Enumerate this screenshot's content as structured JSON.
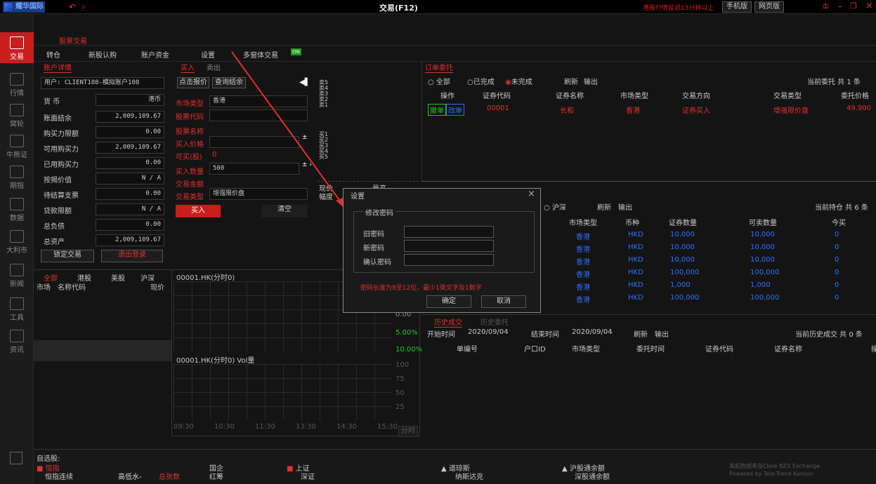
{
  "titlebar": {
    "logo": "耀华国际",
    "title": "交易(F12)",
    "delay_notice": "港股行情延迟15分钟以上",
    "mobile": "手机版",
    "web": "网页版"
  },
  "sidebar": {
    "items": [
      {
        "label": "交易"
      },
      {
        "label": "行情"
      },
      {
        "label": "窝轮"
      },
      {
        "label": "牛熊证"
      },
      {
        "label": "期指"
      },
      {
        "label": "数据"
      },
      {
        "label": "大利市"
      },
      {
        "label": "新闻"
      },
      {
        "label": "工具"
      },
      {
        "label": "资讯"
      }
    ]
  },
  "toolbar": {
    "section": "股票交易",
    "transfer": "转仓",
    "ipo": "新股认购",
    "funds": "账户资金",
    "settings": "设置",
    "multi": "多窗体交易",
    "toggle": "ON"
  },
  "account": {
    "tab": "账户详情",
    "user": "用户: CLIENT108-模拟账户108",
    "currency_label": "货 币",
    "currency": "港币",
    "rows": [
      {
        "label": "账面结余",
        "value": "2,009,109.67"
      },
      {
        "label": "购买力限额",
        "value": "0.00"
      },
      {
        "label": "可用购买力",
        "value": "2,009,109.67"
      },
      {
        "label": "已用购买力",
        "value": "0.00"
      },
      {
        "label": "按揭价值",
        "value": "N / A"
      },
      {
        "label": "待结算支票",
        "value": "0.00"
      },
      {
        "label": "贷款限额",
        "value": "N / A"
      },
      {
        "label": "总负债",
        "value": "0.00"
      },
      {
        "label": "总资产",
        "value": "2,009,109.67"
      }
    ],
    "lock": "锁定交易",
    "logout": "退出登录"
  },
  "order_form": {
    "buy_tab": "买入",
    "sell_tab": "卖出",
    "quote": "点击报价",
    "query": "查询结余",
    "market_label": "市场类型",
    "market": "香港",
    "code_label": "股票代码",
    "name_label": "股票名称",
    "price_label": "买入价格",
    "canbuy_label": "可买(股)",
    "canbuy": "0",
    "qty_label": "买入数量",
    "qty": "500",
    "amount_label": "交易金额",
    "type_label": "交易类型",
    "type": "增强限价盘",
    "buy_btn": "买入",
    "clear_btn": "清空",
    "sell_levels": [
      "卖5",
      "卖4",
      "卖3",
      "卖2",
      "卖1"
    ],
    "buy_levels": [
      "买1",
      "买2",
      "买3",
      "买4",
      "买5"
    ],
    "last_label": "现价",
    "change_label": "幅度",
    "high_label": "最高"
  },
  "watch": {
    "tabs": [
      "全部",
      "港股",
      "美股",
      "沪深"
    ],
    "col_market": "市场",
    "col_name": "名称代码",
    "col_price": "现价",
    "dash": "-"
  },
  "chart": {
    "title": "00001.HK(分时0)",
    "vol_title": "00001.HK(分时0) Vol量",
    "pct_labels": [
      "0.00",
      "5.00%",
      "10.00%"
    ],
    "vol_labels": [
      "100",
      "75",
      "50",
      "25"
    ],
    "times": [
      "09:30",
      "10:30",
      "11:30",
      "13:30",
      "14:30",
      "15:30"
    ],
    "mode": "分时"
  },
  "orders": {
    "tab": "订单委托",
    "filters": [
      "全部",
      "已完成",
      "未完成"
    ],
    "refresh": "刷新",
    "export": "输出",
    "summary": "当前委托  共 1 条",
    "headers": [
      "操作",
      "证券代码",
      "证券名称",
      "市场类型",
      "交易方向",
      "交易类型",
      "委托价格"
    ],
    "row": {
      "cancel": "撤单",
      "modify": "改单",
      "code": "00001",
      "name": "长和",
      "market": "香港",
      "direction": "证券买入",
      "type": "增强限价盘",
      "price": "49.900"
    }
  },
  "positions": {
    "filter": "沪深",
    "refresh": "刷新",
    "export": "输出",
    "summary": "当前持仓  共 6 条",
    "headers": [
      "市场类型",
      "币种",
      "证券数量",
      "可卖数量",
      "今买"
    ],
    "rows": [
      {
        "market": "香港",
        "cur": "HKD",
        "qty": "10,000",
        "sell": "10,000",
        "today": "0"
      },
      {
        "market": "香港",
        "cur": "HKD",
        "qty": "10,000",
        "sell": "10,000",
        "today": "0"
      },
      {
        "market": "香港",
        "cur": "HKD",
        "qty": "10,000",
        "sell": "10,000",
        "today": "0"
      },
      {
        "market": "香港",
        "cur": "HKD",
        "qty": "100,000",
        "sell": "100,000",
        "today": "0"
      },
      {
        "market": "香港",
        "cur": "HKD",
        "qty": "1,000",
        "sell": "1,000",
        "today": "0"
      },
      {
        "market": "香港",
        "cur": "HKD",
        "qty": "100,000",
        "sell": "100,000",
        "today": "0"
      }
    ]
  },
  "history": {
    "tab": "历史成交",
    "tab2": "历史委托",
    "start_label": "开始时间",
    "start": "2020/09/04",
    "end_label": "结束时间",
    "end": "2020/09/04",
    "refresh": "刷新",
    "export": "输出",
    "summary": "当前历史成交  共 0 条",
    "headers": [
      "单编号",
      "户口ID",
      "市场类型",
      "委托时间",
      "证券代码",
      "证券名称",
      "操"
    ]
  },
  "dialog": {
    "title": "设置",
    "close": "×",
    "group": "修改密码",
    "old": "旧密码",
    "new": "新密码",
    "confirm": "确认密码",
    "hint": "密码长度为8至12位，最少1英文字及1数字",
    "ok": "确定",
    "cancel": "取消"
  },
  "bottom": {
    "watchlist": "自选股:",
    "r1": [
      "恒指",
      "国企",
      "上证",
      "道琼斯",
      "沪股通余额"
    ],
    "r2": [
      "恒指连续",
      "高低水-",
      "总张数",
      "红筹",
      "深证",
      "纳斯达克",
      "深股通余额"
    ],
    "dash": "-",
    "credit1": "美股数据来自Cboe BZX Exchange",
    "credit2": "Powered by Tele-Trend Konson"
  }
}
